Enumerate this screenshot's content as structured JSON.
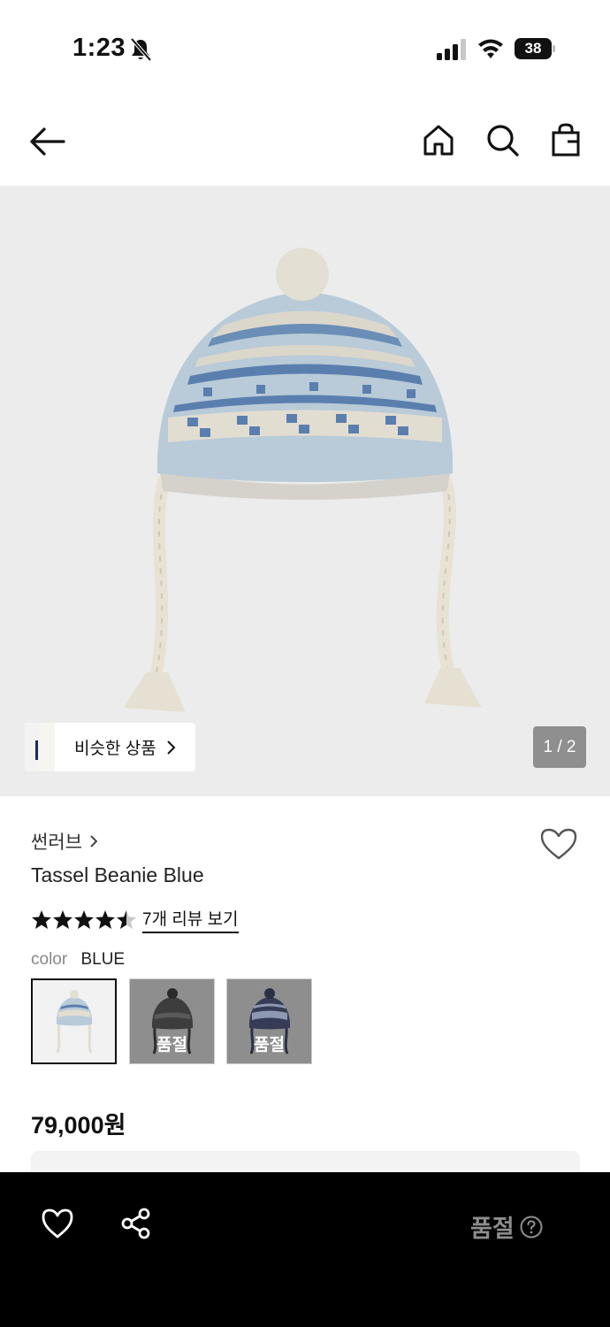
{
  "status_bar": {
    "time": "1:23",
    "battery": "38"
  },
  "header": {
    "back_icon": "arrow-left-icon",
    "home_icon": "home-icon",
    "search_icon": "search-icon",
    "bag_icon": "shopping-bag-icon"
  },
  "gallery": {
    "similar_label": "비슷한 상품",
    "page_indicator": "1 / 2"
  },
  "product": {
    "brand": "썬러브",
    "title": "Tassel Beanie Blue",
    "rating": 4.5,
    "rating_max": 5,
    "review_link": "7개 리뷰 보기",
    "color_label": "color",
    "color_value": "BLUE",
    "swatches": [
      {
        "name": "blue",
        "selected": true,
        "sold_out": false,
        "sold_out_label": ""
      },
      {
        "name": "charcoal",
        "selected": false,
        "sold_out": true,
        "sold_out_label": "품절"
      },
      {
        "name": "navy",
        "selected": false,
        "sold_out": true,
        "sold_out_label": "품절"
      }
    ],
    "price": "79,000원"
  },
  "bottom_bar": {
    "heart_icon": "heart-icon",
    "share_icon": "share-icon",
    "sold_out_label": "품절",
    "help_icon": "question-circle-icon"
  },
  "colors": {
    "background": "#ffffff",
    "image_bg": "#ececec",
    "bottom_bar": "#000000",
    "sold_out_text": "#8d8d8d",
    "beanie_light_blue": "#b8cbd8",
    "beanie_pattern_blue": "#5a7fae",
    "beanie_cream": "#e9e3d6"
  }
}
